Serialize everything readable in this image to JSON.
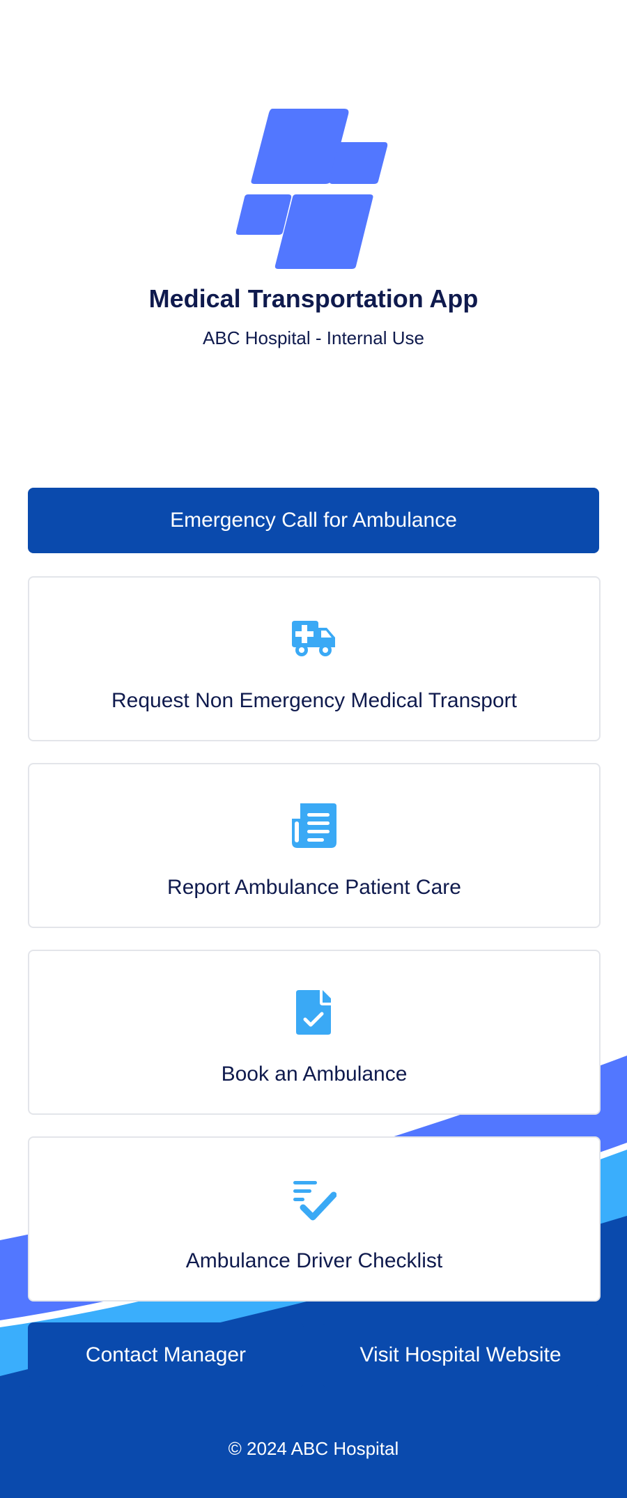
{
  "header": {
    "title": "Medical Transportation App",
    "subtitle": "ABC Hospital - Internal Use"
  },
  "emergency_button": {
    "label": "Emergency Call for Ambulance"
  },
  "cards": [
    {
      "label": "Request Non Emergency Medical Transport",
      "icon": "ambulance-icon"
    },
    {
      "label": "Report Ambulance Patient Care",
      "icon": "document-list-icon"
    },
    {
      "label": "Book an Ambulance",
      "icon": "file-check-icon"
    },
    {
      "label": "Ambulance Driver Checklist",
      "icon": "checklist-icon"
    }
  ],
  "footer": {
    "contact_manager": "Contact Manager",
    "visit_website": "Visit Hospital Website",
    "copyright": "© 2024 ABC Hospital"
  },
  "colors": {
    "primary_dark_blue": "#0a4aad",
    "logo_blue": "#5277ff",
    "icon_light_blue": "#3aa9f5",
    "text_navy": "#0f1a4d",
    "wave_periwinkle": "#5277ff",
    "wave_sky": "#3aaefc"
  }
}
